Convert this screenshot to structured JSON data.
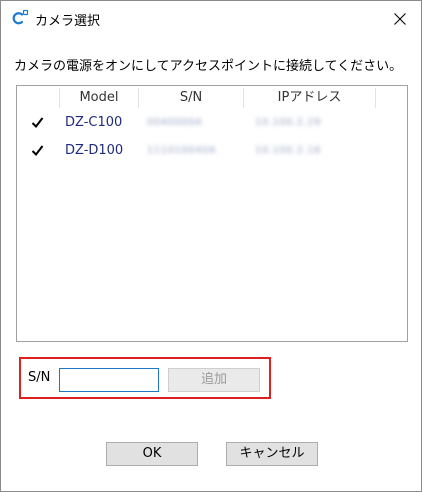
{
  "window": {
    "title": "カメラ選択"
  },
  "instruction": "カメラの電源をオンにしてアクセスポイントに接続してください。",
  "camera_list": {
    "columns": [
      "Model",
      "S/N",
      "IPアドレス"
    ],
    "rows": [
      {
        "checked": true,
        "model": "DZ-C100",
        "sn": "0040000A",
        "ip": "10.100.2.29"
      },
      {
        "checked": true,
        "model": "DZ-D100",
        "sn": "111010040A",
        "ip": "10.100.2.16"
      }
    ]
  },
  "sn_entry": {
    "label": "S/N",
    "value": "",
    "add_label": "追加"
  },
  "buttons": {
    "ok_label": "OK",
    "cancel_label": "キャンセル"
  },
  "colors": {
    "highlight_border": "#e02020",
    "model_text": "#1f2a7a",
    "input_focus": "#1e78c8"
  },
  "icons": {
    "app": "camera-app-icon",
    "close": "close-icon",
    "checkbox": "checkmark-icon"
  }
}
